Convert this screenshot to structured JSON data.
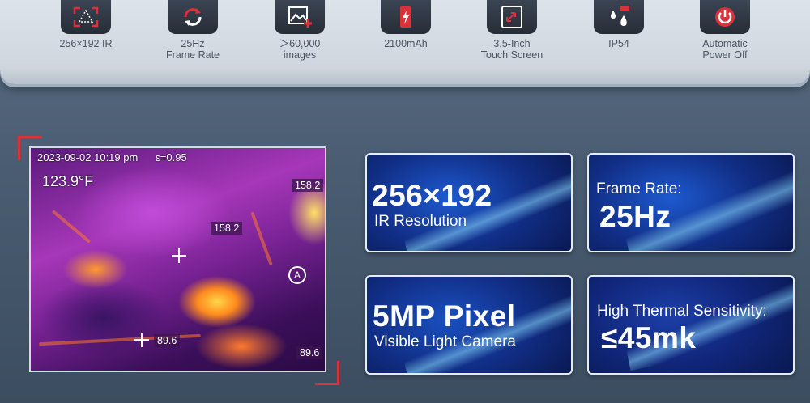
{
  "features": [
    {
      "icon": "ir-resolution-icon",
      "label": "256×192 IR"
    },
    {
      "icon": "refresh-icon",
      "label": "25Hz\nFrame Rate"
    },
    {
      "icon": "image-add-icon",
      "label": "＞60,000\nimages"
    },
    {
      "icon": "battery-icon",
      "label": "2100mAh"
    },
    {
      "icon": "touch-screen-icon",
      "label": "3.5-Inch\nTouch Screen"
    },
    {
      "icon": "water-drops-icon",
      "label": "IP54"
    },
    {
      "icon": "power-icon",
      "label": "Automatic\nPower Off"
    }
  ],
  "thermal": {
    "datetime": "2023-09-02  10:19 pm",
    "emissivity": "ε=0.95",
    "center_temp": "123.9°F",
    "max_top": "158.2",
    "hot_spot": "158.2",
    "cold_spot": "89.6",
    "min_bottom": "89.6",
    "marker": "A"
  },
  "cards": [
    {
      "big": "256×192",
      "small": "IR Resolution"
    },
    {
      "small": "Frame Rate:",
      "big": "25Hz"
    },
    {
      "big": "5MP Pixel",
      "small": "Visible Light Camera"
    },
    {
      "small": "High Thermal Sensitivity:",
      "big": "≤45mk"
    }
  ],
  "colors": {
    "accent": "#d8323b",
    "card_blue": "#112e86"
  }
}
